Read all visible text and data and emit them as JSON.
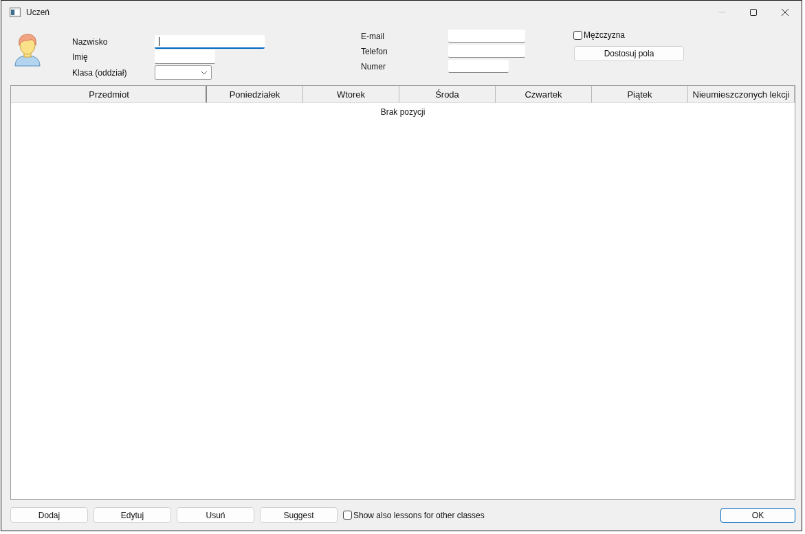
{
  "window": {
    "title": "Uczeń"
  },
  "fields_left": [
    {
      "label": "Nazwisko",
      "kind": "text",
      "focused": true
    },
    {
      "label": "Imię",
      "kind": "text",
      "focused": false
    },
    {
      "label": "Klasa (oddział)",
      "kind": "dropdown",
      "focused": false
    }
  ],
  "fields_right": [
    {
      "label": "E-mail",
      "kind": "text",
      "focused": false
    },
    {
      "label": "Telefon",
      "kind": "text",
      "focused": false
    },
    {
      "label": "Numer",
      "kind": "text",
      "focused": false
    }
  ],
  "gender_checkbox": {
    "label": "Mężczyzna",
    "checked": false
  },
  "customize_button": "Dostosuj pola",
  "table": {
    "columns": [
      "Przedmiot",
      "Poniedziałek",
      "Wtorek",
      "Środa",
      "Czwartek",
      "Piątek",
      "Nieumieszczonych lekcji"
    ],
    "empty_message": "Brak pozycji"
  },
  "buttons": [
    "Dodaj",
    "Edytuj",
    "Usuń",
    "Suggest"
  ],
  "other_classes_checkbox": {
    "label": "Show also lessons for other classes",
    "checked": false
  },
  "ok_button": "OK"
}
